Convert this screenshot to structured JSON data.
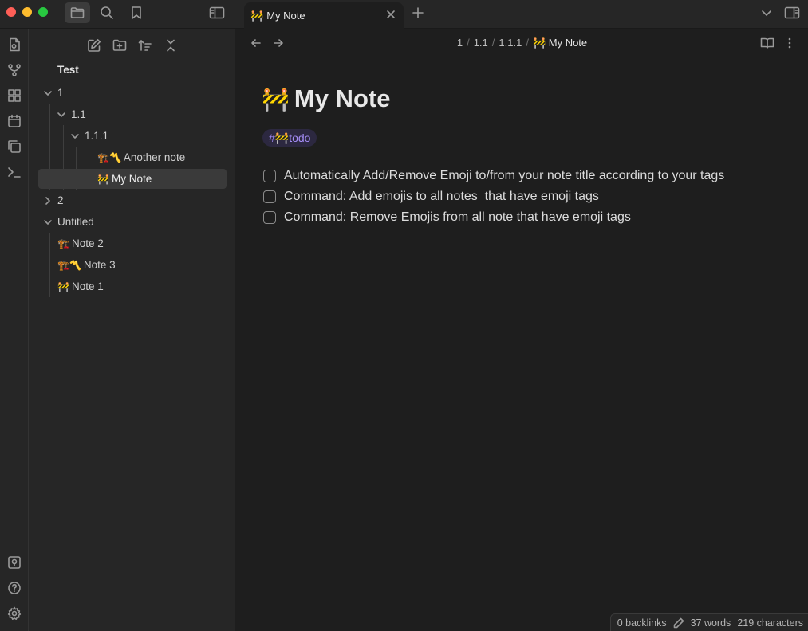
{
  "titlebar": {
    "traffic_colors": [
      "#ff5f57",
      "#febc2e",
      "#28c840"
    ],
    "active_tab": {
      "emoji": "🚧",
      "title": "My Note"
    }
  },
  "sidebar": {
    "vault_name": "Test",
    "tree": [
      {
        "label": "1",
        "type": "folder",
        "expanded": true
      },
      {
        "label": "1.1",
        "type": "folder",
        "expanded": true
      },
      {
        "label": "1.1.1",
        "type": "folder",
        "expanded": true
      },
      {
        "emoji": "🏗️〽️",
        "label": "Another note",
        "type": "file"
      },
      {
        "emoji": "🚧",
        "label": "My Note",
        "type": "file",
        "selected": true
      },
      {
        "label": "2",
        "type": "folder",
        "expanded": false
      },
      {
        "label": "Untitled",
        "type": "folder",
        "expanded": true
      },
      {
        "emoji": "🏗️",
        "label": "Note 2",
        "type": "file"
      },
      {
        "emoji": "🏗️〽️",
        "label": "Note 3",
        "type": "file"
      },
      {
        "emoji": "🚧",
        "label": "Note 1",
        "type": "file"
      }
    ]
  },
  "main": {
    "breadcrumb": [
      "1",
      "1.1",
      "1.1.1"
    ],
    "breadcrumb_current": {
      "emoji": "🚧",
      "label": "My Note"
    },
    "title_emoji": "🚧",
    "title": "My Note",
    "tag": "#🚧todo",
    "tasks": [
      "Automatically Add/Remove Emoji to/from your note title according to your tags",
      "Command: Add emojis to all notes  that have emoji tags",
      "Command: Remove Emojis from all note that have emoji tags"
    ]
  },
  "statusbar": {
    "backlinks": "0 backlinks",
    "words": "37 words",
    "characters": "219 characters"
  },
  "colors": {
    "accent_tag": "#a48cf5",
    "background": "#1e1e1e",
    "sidebar": "#262626"
  }
}
